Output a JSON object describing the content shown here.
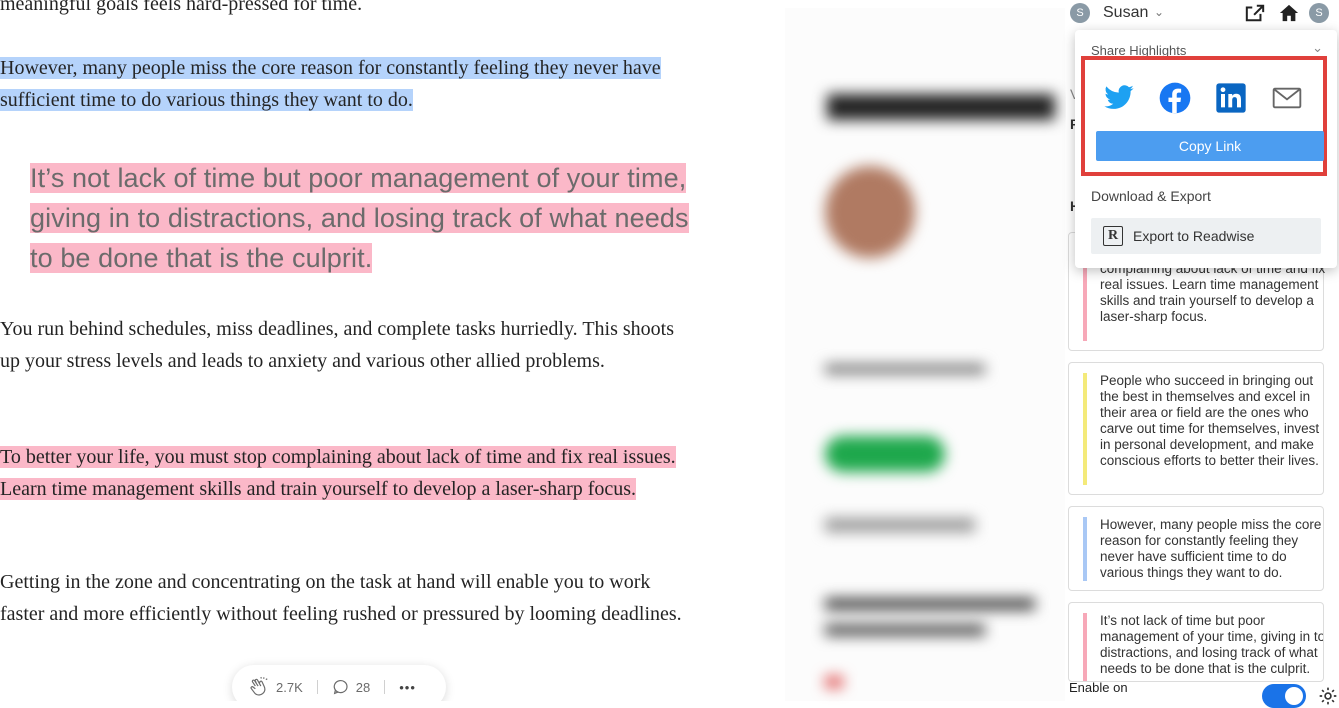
{
  "article": {
    "p0": "meaningful goals feels hard-pressed for time.",
    "p1": "However, many people miss the core reason for constantly feeling they never have sufficient time to do various things they want to do.",
    "quote": "It’s not lack of time but poor management of your time, giving in to distractions, and losing track of what needs to be done that is the culprit.",
    "p2": "You run behind schedules, miss deadlines, and complete tasks hurriedly. This shoots up your stress levels and leads to anxiety and various other allied problems.",
    "p3": "To better your life, you must stop complaining about lack of time and fix real issues. Learn time management skills and train yourself to develop a laser-sharp focus.",
    "p4": "Getting in the zone and concentrating on the task at hand will enable you to work faster and more efficiently without feeling rushed or pressured by looming deadlines.",
    "claps": "2.7K",
    "comments": "28",
    "more": "•••"
  },
  "extension": {
    "user_initial": "S",
    "user_name": "Susan",
    "user_chevron": "⌄",
    "side_letters": [
      "V",
      "F",
      "H"
    ],
    "popup": {
      "header": "Share Highlights",
      "header_chevron": "⌄",
      "copy_link": "Copy Link",
      "download_label": "Download & Export",
      "readwise_icon": "R",
      "readwise_label": "Export to Readwise"
    },
    "cards": [
      {
        "color": "#f7a8b8",
        "text": "complaining about lack of time and fix real issues. Learn time management skills and train yourself to develop a laser-sharp focus."
      },
      {
        "color": "#f4ea7a",
        "text": "People who succeed in bringing out the best in themselves and excel in their area or field are the ones who carve out time for themselves, invest in personal development, and make conscious efforts to better their lives."
      },
      {
        "color": "#a9c8f5",
        "text": "However, many people miss the core reason for constantly feeling they never have sufficient time to do various things they want to do."
      },
      {
        "color": "#f7a8b8",
        "text": "It’s not lack of time but poor management of your time, giving in to distractions, and losing track of what needs to be done that is the culprit."
      }
    ],
    "enable_label": "Enable on",
    "toggle_on": true
  },
  "colors": {
    "highlight_blue": "#b5d3fb",
    "highlight_pink": "#fbb8c8",
    "twitter": "#1da1f2",
    "facebook": "#1877f2",
    "linkedin": "#0a66c2",
    "copy_button": "#4c9df0",
    "share_box_border": "#e0403b"
  }
}
